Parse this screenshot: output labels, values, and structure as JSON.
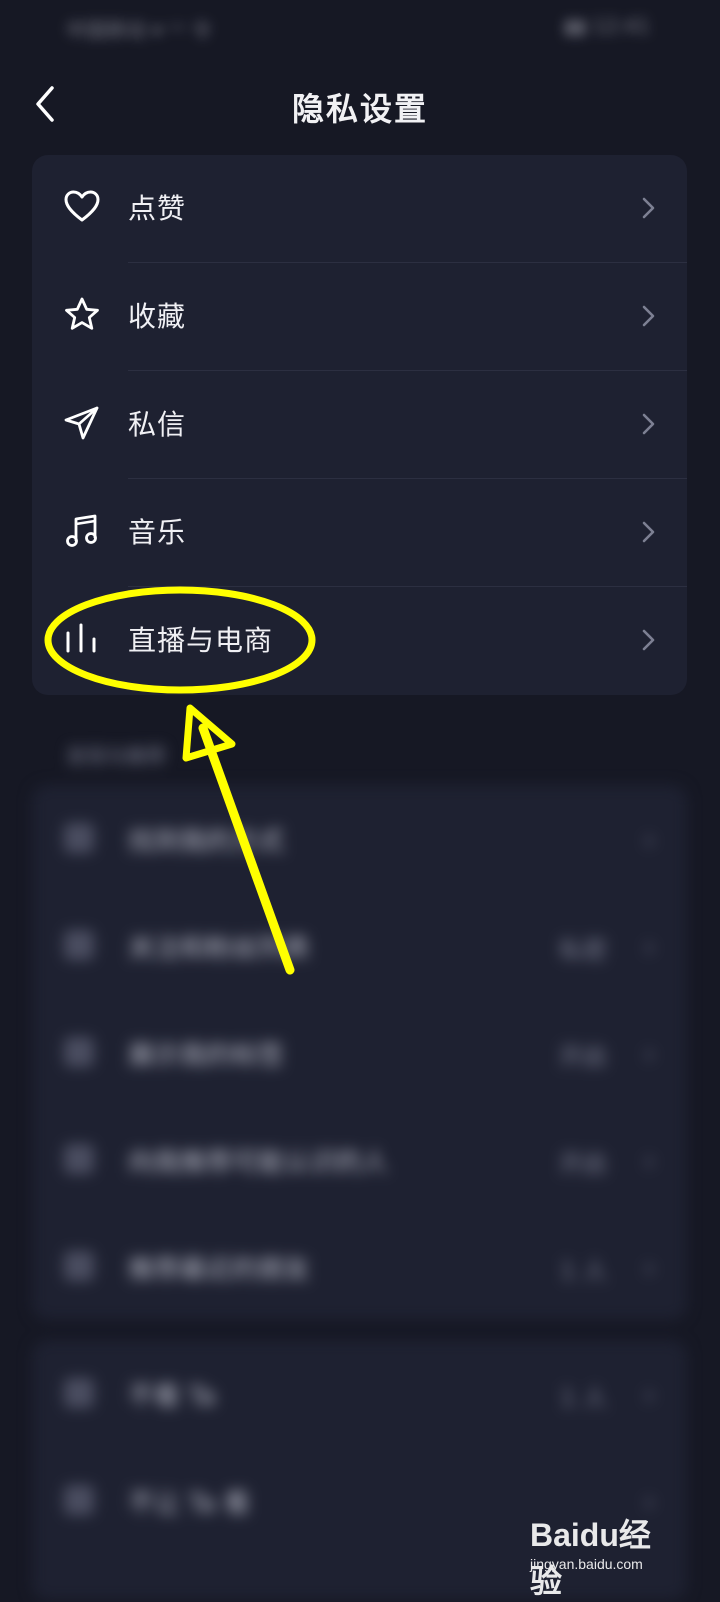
{
  "status_bar": {
    "carrier": "中国移动 ▾ ᵛᵒ 令",
    "right": "▮▮ 12:41"
  },
  "header": {
    "title": "隐私设置"
  },
  "menu": {
    "items": [
      {
        "label": "点赞",
        "icon": "heart-icon"
      },
      {
        "label": "收藏",
        "icon": "star-icon"
      },
      {
        "label": "私信",
        "icon": "paper-plane-icon"
      },
      {
        "label": "音乐",
        "icon": "music-note-icon"
      },
      {
        "label": "直播与电商",
        "icon": "live-bars-icon"
      }
    ]
  },
  "blurred_section": {
    "label": "发现与推荐",
    "items": [
      {
        "label": "找到我的方式",
        "value": ""
      },
      {
        "label": "关注和粉丝列表",
        "value": "私密"
      },
      {
        "label": "展示我的标签",
        "value": "开启"
      },
      {
        "label": "向我推荐可能认识的人",
        "value": "开启"
      },
      {
        "label": "推荐最近的朋友",
        "value": "1 人"
      }
    ],
    "items2": [
      {
        "label": "不看 Ta",
        "value": "1 人"
      },
      {
        "label": "不让 Ta 看",
        "value": ""
      }
    ]
  },
  "annotation": {
    "highlight_color": "#ffff00"
  },
  "watermark": {
    "brand": "Baidu经验",
    "url": "jingyan.baidu.com"
  }
}
